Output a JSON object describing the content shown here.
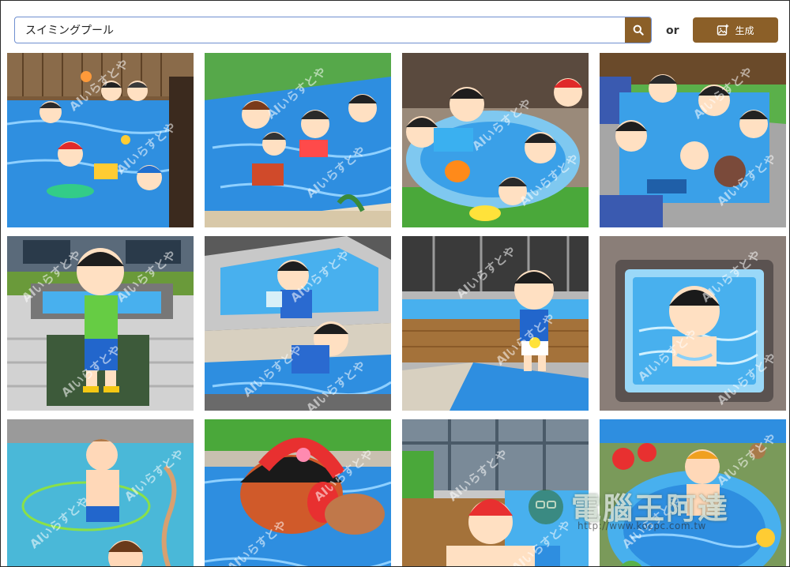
{
  "search": {
    "value": "スイミングプール",
    "placeholder": ""
  },
  "or_label": "or",
  "generate_button": {
    "label": "生成"
  },
  "watermark": "AIいらすとや",
  "logo": {
    "brand": "電腦王阿達",
    "url": "http://www.kocpc.com.tw"
  },
  "colors": {
    "accent": "#8b5f28",
    "search_border": "#6f8fd0"
  },
  "icons": {
    "search_button": "search-icon",
    "generate_button": "image-plus-icon"
  },
  "gallery": {
    "images": [
      {
        "scene": "kids-playing-in-pool-with-toys"
      },
      {
        "scene": "kids-in-pool-with-floats"
      },
      {
        "scene": "kids-around-round-pool"
      },
      {
        "scene": "kids-in-square-pool-with-crates"
      },
      {
        "scene": "child-standing-by-small-pool"
      },
      {
        "scene": "children-at-pool-edge"
      },
      {
        "scene": "boy-standing-between-pools"
      },
      {
        "scene": "child-in-square-bath"
      },
      {
        "scene": "baby-in-pool-with-hose"
      },
      {
        "scene": "girl-swimming-with-cap"
      },
      {
        "scene": "child-with-red-cap-at-pool"
      },
      {
        "scene": "baby-in-round-pool-with-balls"
      }
    ]
  }
}
